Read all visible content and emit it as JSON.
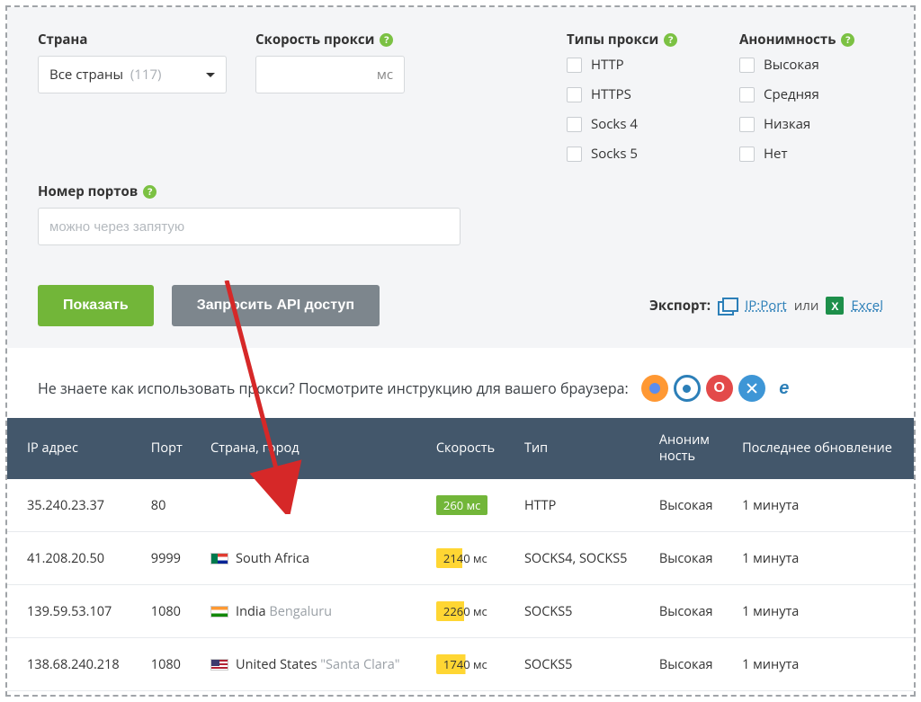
{
  "filters": {
    "country_label": "Страна",
    "country_value": "Все страны",
    "country_count": "(117)",
    "speed_label": "Скорость прокси",
    "speed_unit": "мс",
    "ports_label": "Номер портов",
    "ports_placeholder": "можно через запятую",
    "types_label": "Типы прокси",
    "types": [
      "HTTP",
      "HTTPS",
      "Socks 4",
      "Socks 5"
    ],
    "anon_label": "Анонимность",
    "anon": [
      "Высокая",
      "Средняя",
      "Низкая",
      "Нет"
    ]
  },
  "actions": {
    "show": "Показать",
    "api": "Запросить API доступ",
    "export_label": "Экспорт:",
    "ipport": "IP:Port",
    "or": "или",
    "excel": "Excel"
  },
  "instruction": "Не знаете как использовать прокси? Посмотрите инструкцию для вашего браузера:",
  "table": {
    "headers": {
      "ip": "IP адрес",
      "port": "Порт",
      "country": "Страна, город",
      "speed": "Скорость",
      "type": "Тип",
      "anon": "Аноним\nность",
      "updated": "Последнее обновление"
    },
    "rows": [
      {
        "ip": "35.240.23.37",
        "port": "80",
        "flag": "",
        "country": "",
        "city": "",
        "speed": "260 мс",
        "speed_cls": "sp-green",
        "type": "HTTP",
        "anon": "Высокая",
        "updated": "1 минута"
      },
      {
        "ip": "41.208.20.50",
        "port": "9999",
        "flag": "za",
        "country": "South Africa",
        "city": "",
        "speed": "2140 мс",
        "speed_cls": "sp-yellow-part",
        "type": "SOCKS4, SOCKS5",
        "anon": "Высокая",
        "updated": "1 минута"
      },
      {
        "ip": "139.59.53.107",
        "port": "1080",
        "flag": "in",
        "country": "India",
        "city": "Bengaluru",
        "speed": "2260 мс",
        "speed_cls": "sp-yellow-part2",
        "type": "SOCKS5",
        "anon": "Высокая",
        "updated": "1 минута"
      },
      {
        "ip": "138.68.240.218",
        "port": "1080",
        "flag": "us",
        "country": "United States",
        "city": "\"Santa Clara\"",
        "speed": "1740 мс",
        "speed_cls": "sp-yellow-part3",
        "type": "SOCKS5",
        "anon": "Высокая",
        "updated": "1 минута"
      }
    ]
  }
}
